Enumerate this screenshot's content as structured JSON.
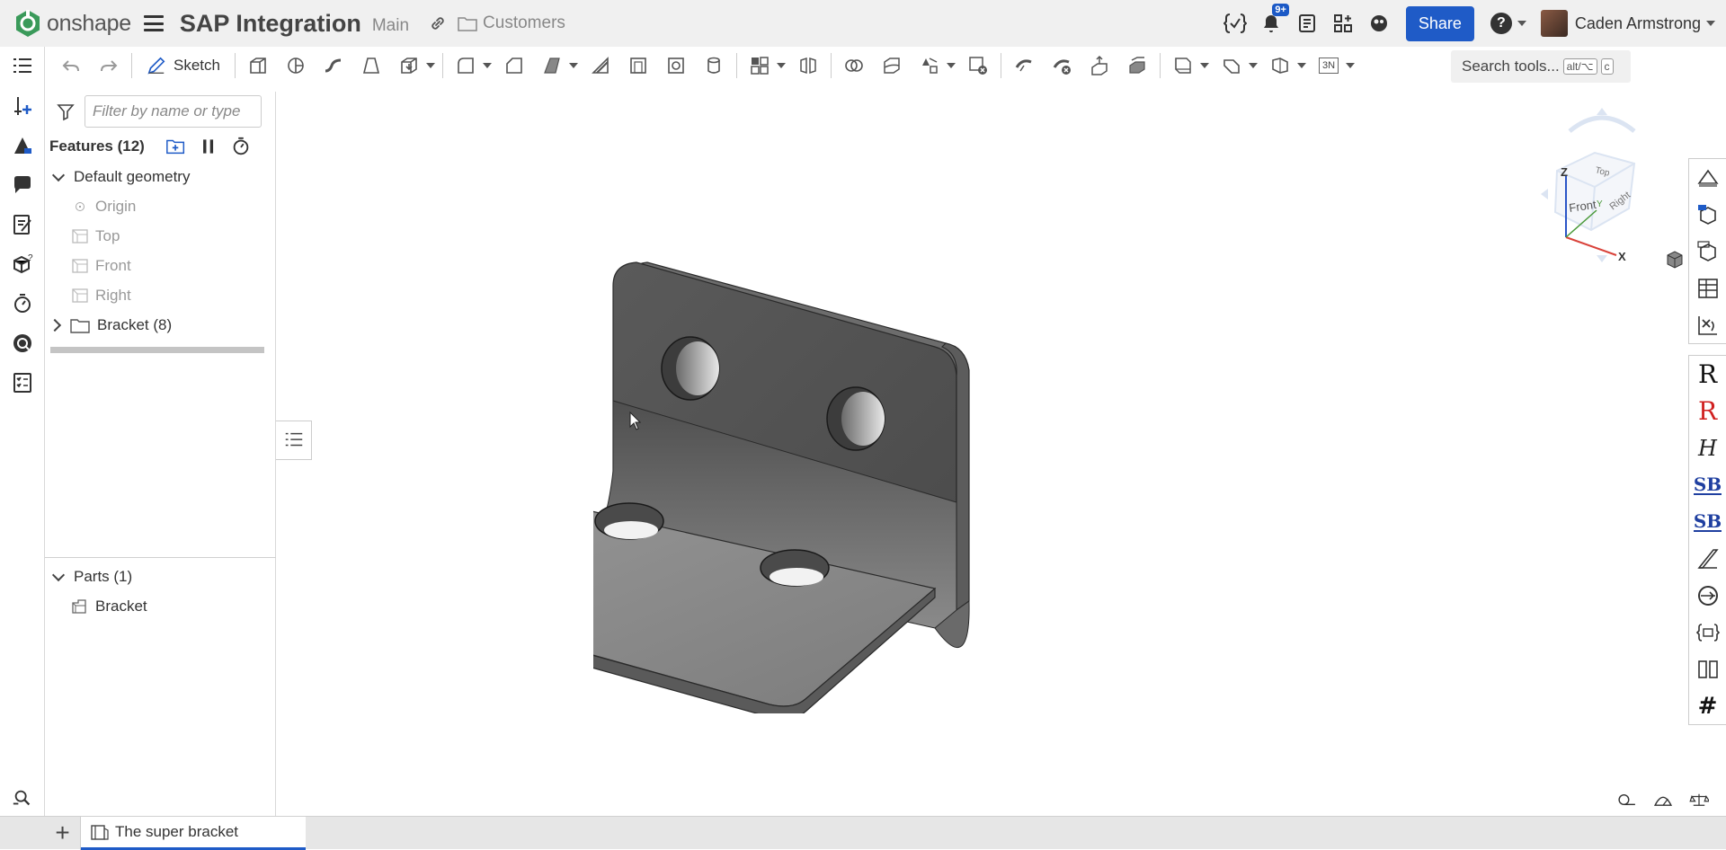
{
  "header": {
    "logo_text": "onshape",
    "document_title": "SAP Integration",
    "branch": "Main",
    "folder": "Customers",
    "notification_badge": "9+",
    "share_label": "Share",
    "user_name": "Caden Armstrong"
  },
  "toolbar": {
    "sketch_label": "Sketch",
    "view_mode_label": "3N",
    "search_label": "Search tools...",
    "search_shortcut_1": "alt/⌥",
    "search_shortcut_2": "c"
  },
  "feature_panel": {
    "filter_placeholder": "Filter by name or type",
    "features_title": "Features (12)",
    "default_geometry_label": "Default geometry",
    "geometry_items": [
      "Origin",
      "Top",
      "Front",
      "Right"
    ],
    "folder_label": "Bracket (8)",
    "parts_title": "Parts (1)",
    "parts": [
      "Bracket"
    ]
  },
  "view_cube": {
    "faces": [
      "Top",
      "Front",
      "Right"
    ],
    "axes": [
      "Z",
      "Y",
      "X"
    ],
    "colors": {
      "x": "#d9423a",
      "y": "#4a9a3a",
      "z": "#2b55c7"
    }
  },
  "right_rail": {
    "letters": [
      "R",
      "R",
      "H",
      "SB",
      "SB",
      "#"
    ]
  },
  "tabs": {
    "active_tab": "The super bracket"
  },
  "colors": {
    "accent": "#1f5bc7",
    "logo_green": "#3a9a5a",
    "part_dark": "#4f4f4f",
    "part_mid": "#7a7a7a",
    "part_light": "#8c8c8c"
  }
}
